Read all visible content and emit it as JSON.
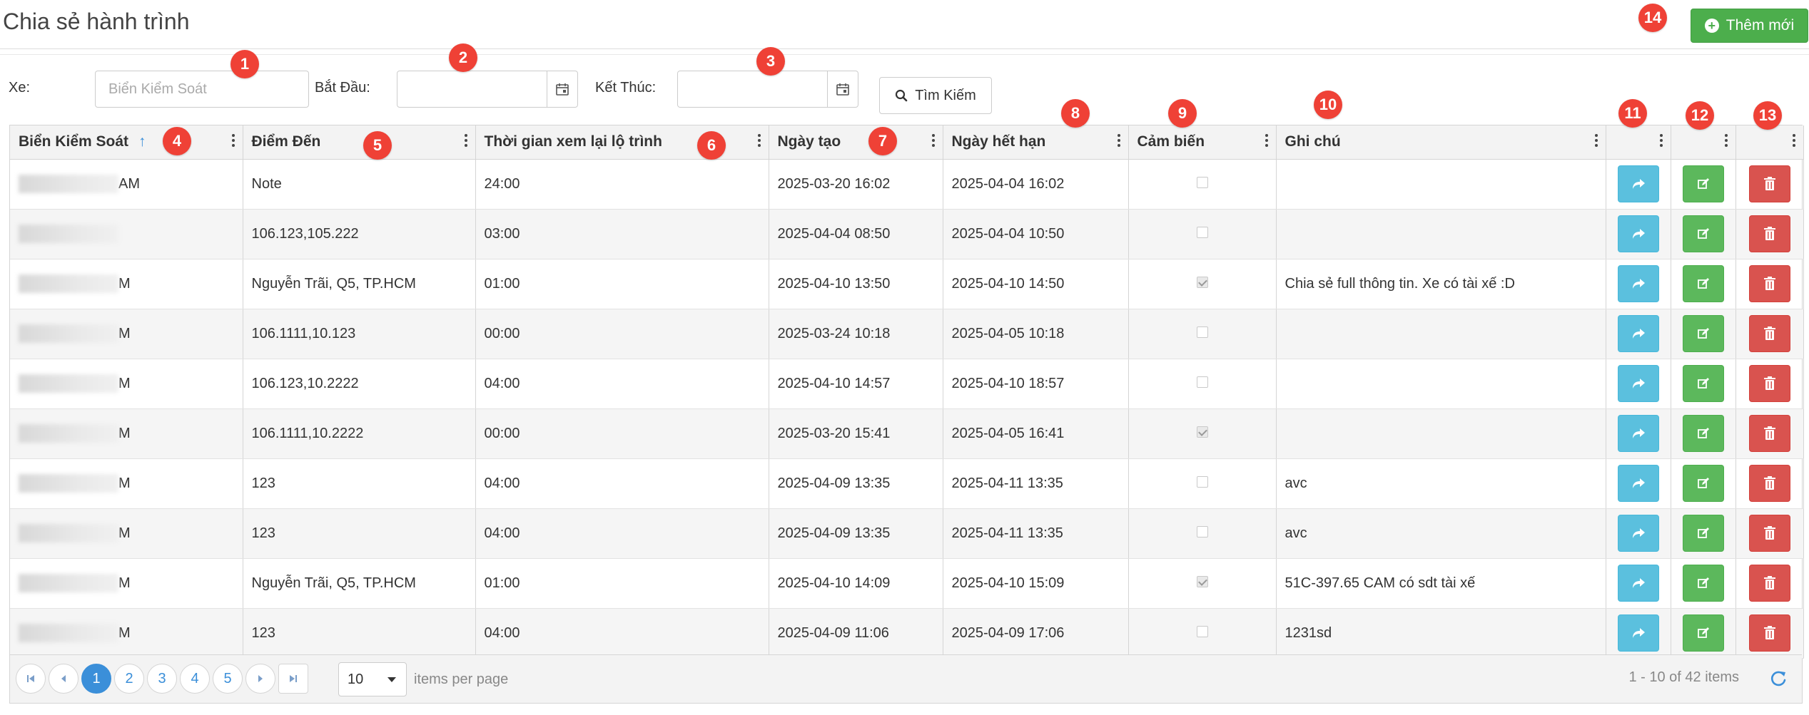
{
  "header": {
    "title": "Chia sẻ hành trình",
    "add_button": "Thêm mới"
  },
  "filters": {
    "vehicle_label": "Xe:",
    "vehicle_placeholder": "Biển Kiểm Soát",
    "start_label": "Bắt Đầu:",
    "end_label": "Kết Thúc:",
    "search_button": "Tìm Kiếm"
  },
  "badges": [
    "1",
    "2",
    "3",
    "4",
    "5",
    "6",
    "7",
    "8",
    "9",
    "10",
    "11",
    "12",
    "13",
    "14"
  ],
  "columns": [
    "Biển Kiểm Soát",
    "Điểm Đến",
    "Thời gian xem lại lộ trình",
    "Ngày tạo",
    "Ngày hết hạn",
    "Cảm biến",
    "Ghi chú"
  ],
  "sort_indicator": "↑",
  "rows": [
    {
      "plate_suffix": "AM",
      "destination": "Note",
      "replay": "24:00",
      "created": "2025-03-20 16:02",
      "expires": "2025-04-04 16:02",
      "sensor": false,
      "note": ""
    },
    {
      "plate_suffix": "",
      "destination": "106.123,105.222",
      "replay": "03:00",
      "created": "2025-04-04 08:50",
      "expires": "2025-04-04 10:50",
      "sensor": false,
      "note": ""
    },
    {
      "plate_suffix": "M",
      "destination": "Nguyễn Trãi, Q5, TP.HCM",
      "replay": "01:00",
      "created": "2025-04-10 13:50",
      "expires": "2025-04-10 14:50",
      "sensor": true,
      "note": "Chia sẻ full thông tin. Xe có tài xế :D"
    },
    {
      "plate_suffix": "M",
      "destination": "106.1111,10.123",
      "replay": "00:00",
      "created": "2025-03-24 10:18",
      "expires": "2025-04-05 10:18",
      "sensor": false,
      "note": ""
    },
    {
      "plate_suffix": "M",
      "destination": "106.123,10.2222",
      "replay": "04:00",
      "created": "2025-04-10 14:57",
      "expires": "2025-04-10 18:57",
      "sensor": false,
      "note": ""
    },
    {
      "plate_suffix": "M",
      "destination": "106.1111,10.2222",
      "replay": "00:00",
      "created": "2025-03-20 15:41",
      "expires": "2025-04-05 16:41",
      "sensor": true,
      "note": ""
    },
    {
      "plate_suffix": "M",
      "destination": "123",
      "replay": "04:00",
      "created": "2025-04-09 13:35",
      "expires": "2025-04-11 13:35",
      "sensor": false,
      "note": "avc"
    },
    {
      "plate_suffix": "M",
      "destination": "123",
      "replay": "04:00",
      "created": "2025-04-09 13:35",
      "expires": "2025-04-11 13:35",
      "sensor": false,
      "note": "avc"
    },
    {
      "plate_suffix": "M",
      "destination": "Nguyễn Trãi, Q5, TP.HCM",
      "replay": "01:00",
      "created": "2025-04-10 14:09",
      "expires": "2025-04-10 15:09",
      "sensor": true,
      "note": "51C-397.65 CAM có sdt tài xế"
    },
    {
      "plate_suffix": "M",
      "destination": "123",
      "replay": "04:00",
      "created": "2025-04-09 11:06",
      "expires": "2025-04-09 17:06",
      "sensor": false,
      "note": "1231sd"
    }
  ],
  "pager": {
    "pages": [
      "1",
      "2",
      "3",
      "4",
      "5"
    ],
    "active_page": "1",
    "per_page": "10",
    "items_per_page_label": "items per page",
    "summary": "1 - 10 of 42 items"
  },
  "colors": {
    "accent": "#3b8fd9",
    "share": "#5bc0de",
    "edit": "#5cb85c",
    "delete": "#d9534f",
    "badge": "#ef4136"
  }
}
